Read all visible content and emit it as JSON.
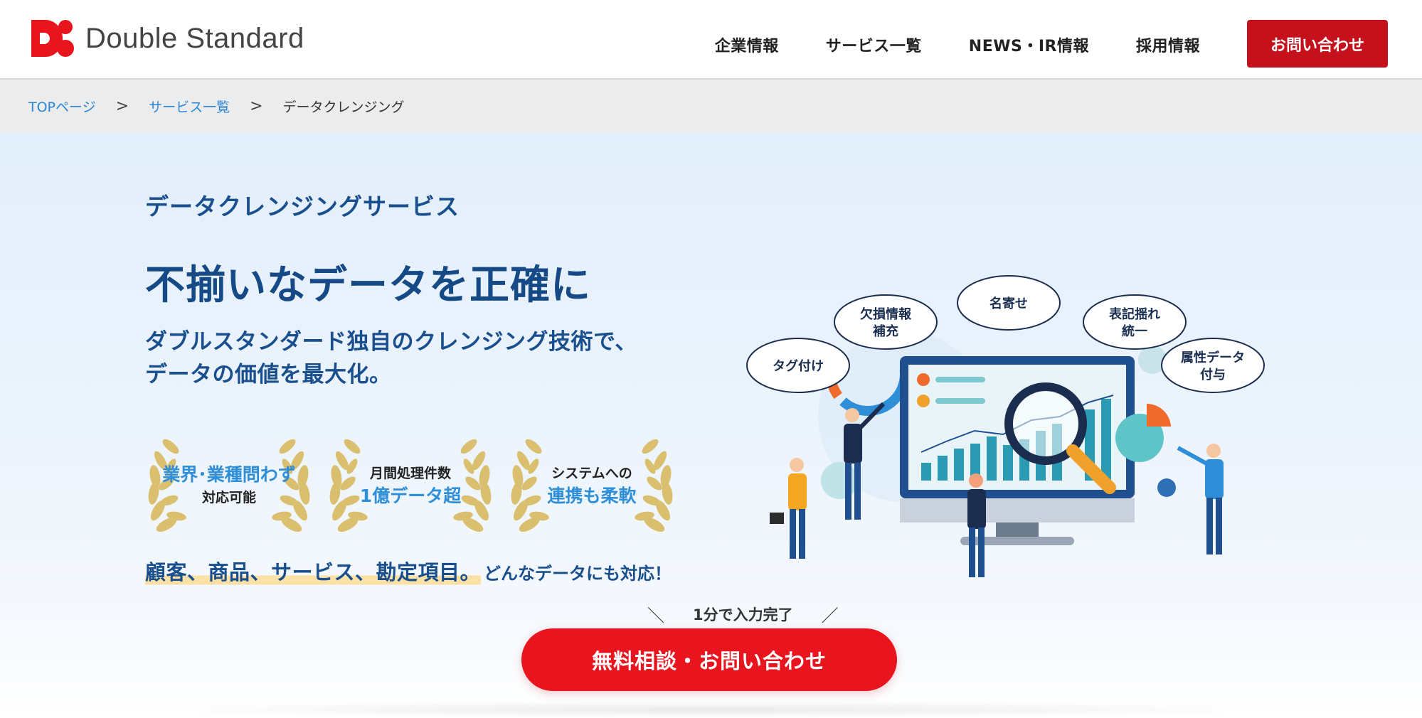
{
  "header": {
    "logo_text": "Double Standard",
    "nav": [
      {
        "label": "企業情報"
      },
      {
        "label": "サービス一覧"
      },
      {
        "label": "NEWS・IR情報"
      },
      {
        "label": "採用情報"
      }
    ],
    "contact_label": "お問い合わせ"
  },
  "breadcrumb": {
    "items": [
      {
        "label": "TOPページ"
      },
      {
        "label": "サービス一覧"
      }
    ],
    "separator": ">",
    "current": "データクレンジング"
  },
  "hero": {
    "kicker": "データクレンジングサービス",
    "headline": "不揃いなデータを正確に",
    "sub_line1": "ダブルスタンダード独自のクレンジング技術で、",
    "sub_line2": "データの価値を最大化。",
    "awards": [
      {
        "blue": "業界･業種問わず",
        "black": "対応可能"
      },
      {
        "black": "月間処理件数",
        "blue": "1億データ超"
      },
      {
        "black": "システムへの",
        "blue": "連携も柔軟"
      }
    ],
    "tagline_strong": "顧客、商品、サービス、勘定項目。",
    "tagline_rest": "どんなデータにも対応！",
    "note_text": "1分で入力完了",
    "note_left": "＼",
    "note_right": "／",
    "cta_label": "無料相談・お問い合わせ"
  },
  "illustration": {
    "bubbles": [
      {
        "line1": "タグ付け",
        "line2": ""
      },
      {
        "line1": "欠損情報",
        "line2": "補充"
      },
      {
        "line1": "名寄せ",
        "line2": ""
      },
      {
        "line1": "表記揺れ",
        "line2": "統一"
      },
      {
        "line1": "属性データ",
        "line2": "付与"
      }
    ]
  },
  "colors": {
    "brand_red": "#e8151e",
    "nav_cta_red": "#c4111b",
    "navy": "#1a4f8e",
    "link_blue": "#2a86d6",
    "award_blue": "#2e8fd8",
    "laurel_gold": "#d9bf6e"
  }
}
